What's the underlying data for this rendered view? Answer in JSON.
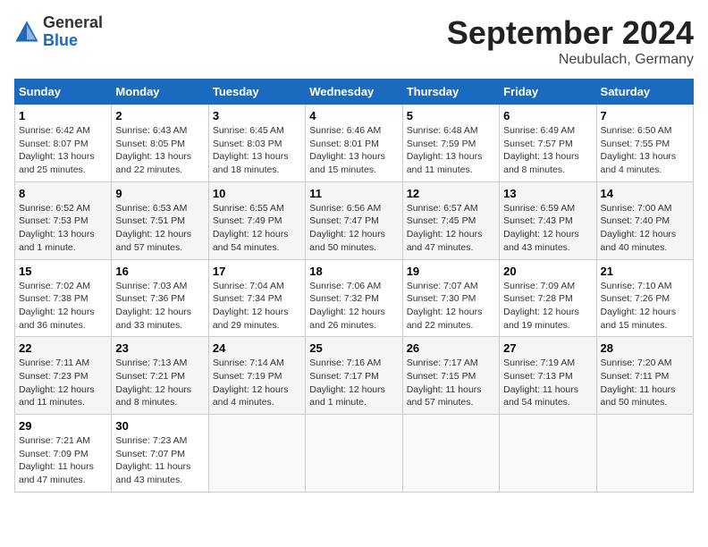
{
  "logo": {
    "general": "General",
    "blue": "Blue"
  },
  "title": "September 2024",
  "location": "Neubulach, Germany",
  "days_of_week": [
    "Sunday",
    "Monday",
    "Tuesday",
    "Wednesday",
    "Thursday",
    "Friday",
    "Saturday"
  ],
  "weeks": [
    [
      {
        "day": 1,
        "sunrise": "6:42 AM",
        "sunset": "8:07 PM",
        "daylight": "13 hours and 25 minutes."
      },
      {
        "day": 2,
        "sunrise": "6:43 AM",
        "sunset": "8:05 PM",
        "daylight": "13 hours and 22 minutes."
      },
      {
        "day": 3,
        "sunrise": "6:45 AM",
        "sunset": "8:03 PM",
        "daylight": "13 hours and 18 minutes."
      },
      {
        "day": 4,
        "sunrise": "6:46 AM",
        "sunset": "8:01 PM",
        "daylight": "13 hours and 15 minutes."
      },
      {
        "day": 5,
        "sunrise": "6:48 AM",
        "sunset": "7:59 PM",
        "daylight": "13 hours and 11 minutes."
      },
      {
        "day": 6,
        "sunrise": "6:49 AM",
        "sunset": "7:57 PM",
        "daylight": "13 hours and 8 minutes."
      },
      {
        "day": 7,
        "sunrise": "6:50 AM",
        "sunset": "7:55 PM",
        "daylight": "13 hours and 4 minutes."
      }
    ],
    [
      {
        "day": 8,
        "sunrise": "6:52 AM",
        "sunset": "7:53 PM",
        "daylight": "13 hours and 1 minute."
      },
      {
        "day": 9,
        "sunrise": "6:53 AM",
        "sunset": "7:51 PM",
        "daylight": "12 hours and 57 minutes."
      },
      {
        "day": 10,
        "sunrise": "6:55 AM",
        "sunset": "7:49 PM",
        "daylight": "12 hours and 54 minutes."
      },
      {
        "day": 11,
        "sunrise": "6:56 AM",
        "sunset": "7:47 PM",
        "daylight": "12 hours and 50 minutes."
      },
      {
        "day": 12,
        "sunrise": "6:57 AM",
        "sunset": "7:45 PM",
        "daylight": "12 hours and 47 minutes."
      },
      {
        "day": 13,
        "sunrise": "6:59 AM",
        "sunset": "7:43 PM",
        "daylight": "12 hours and 43 minutes."
      },
      {
        "day": 14,
        "sunrise": "7:00 AM",
        "sunset": "7:40 PM",
        "daylight": "12 hours and 40 minutes."
      }
    ],
    [
      {
        "day": 15,
        "sunrise": "7:02 AM",
        "sunset": "7:38 PM",
        "daylight": "12 hours and 36 minutes."
      },
      {
        "day": 16,
        "sunrise": "7:03 AM",
        "sunset": "7:36 PM",
        "daylight": "12 hours and 33 minutes."
      },
      {
        "day": 17,
        "sunrise": "7:04 AM",
        "sunset": "7:34 PM",
        "daylight": "12 hours and 29 minutes."
      },
      {
        "day": 18,
        "sunrise": "7:06 AM",
        "sunset": "7:32 PM",
        "daylight": "12 hours and 26 minutes."
      },
      {
        "day": 19,
        "sunrise": "7:07 AM",
        "sunset": "7:30 PM",
        "daylight": "12 hours and 22 minutes."
      },
      {
        "day": 20,
        "sunrise": "7:09 AM",
        "sunset": "7:28 PM",
        "daylight": "12 hours and 19 minutes."
      },
      {
        "day": 21,
        "sunrise": "7:10 AM",
        "sunset": "7:26 PM",
        "daylight": "12 hours and 15 minutes."
      }
    ],
    [
      {
        "day": 22,
        "sunrise": "7:11 AM",
        "sunset": "7:23 PM",
        "daylight": "12 hours and 11 minutes."
      },
      {
        "day": 23,
        "sunrise": "7:13 AM",
        "sunset": "7:21 PM",
        "daylight": "12 hours and 8 minutes."
      },
      {
        "day": 24,
        "sunrise": "7:14 AM",
        "sunset": "7:19 PM",
        "daylight": "12 hours and 4 minutes."
      },
      {
        "day": 25,
        "sunrise": "7:16 AM",
        "sunset": "7:17 PM",
        "daylight": "12 hours and 1 minute."
      },
      {
        "day": 26,
        "sunrise": "7:17 AM",
        "sunset": "7:15 PM",
        "daylight": "11 hours and 57 minutes."
      },
      {
        "day": 27,
        "sunrise": "7:19 AM",
        "sunset": "7:13 PM",
        "daylight": "11 hours and 54 minutes."
      },
      {
        "day": 28,
        "sunrise": "7:20 AM",
        "sunset": "7:11 PM",
        "daylight": "11 hours and 50 minutes."
      }
    ],
    [
      {
        "day": 29,
        "sunrise": "7:21 AM",
        "sunset": "7:09 PM",
        "daylight": "11 hours and 47 minutes."
      },
      {
        "day": 30,
        "sunrise": "7:23 AM",
        "sunset": "7:07 PM",
        "daylight": "11 hours and 43 minutes."
      },
      null,
      null,
      null,
      null,
      null
    ]
  ]
}
